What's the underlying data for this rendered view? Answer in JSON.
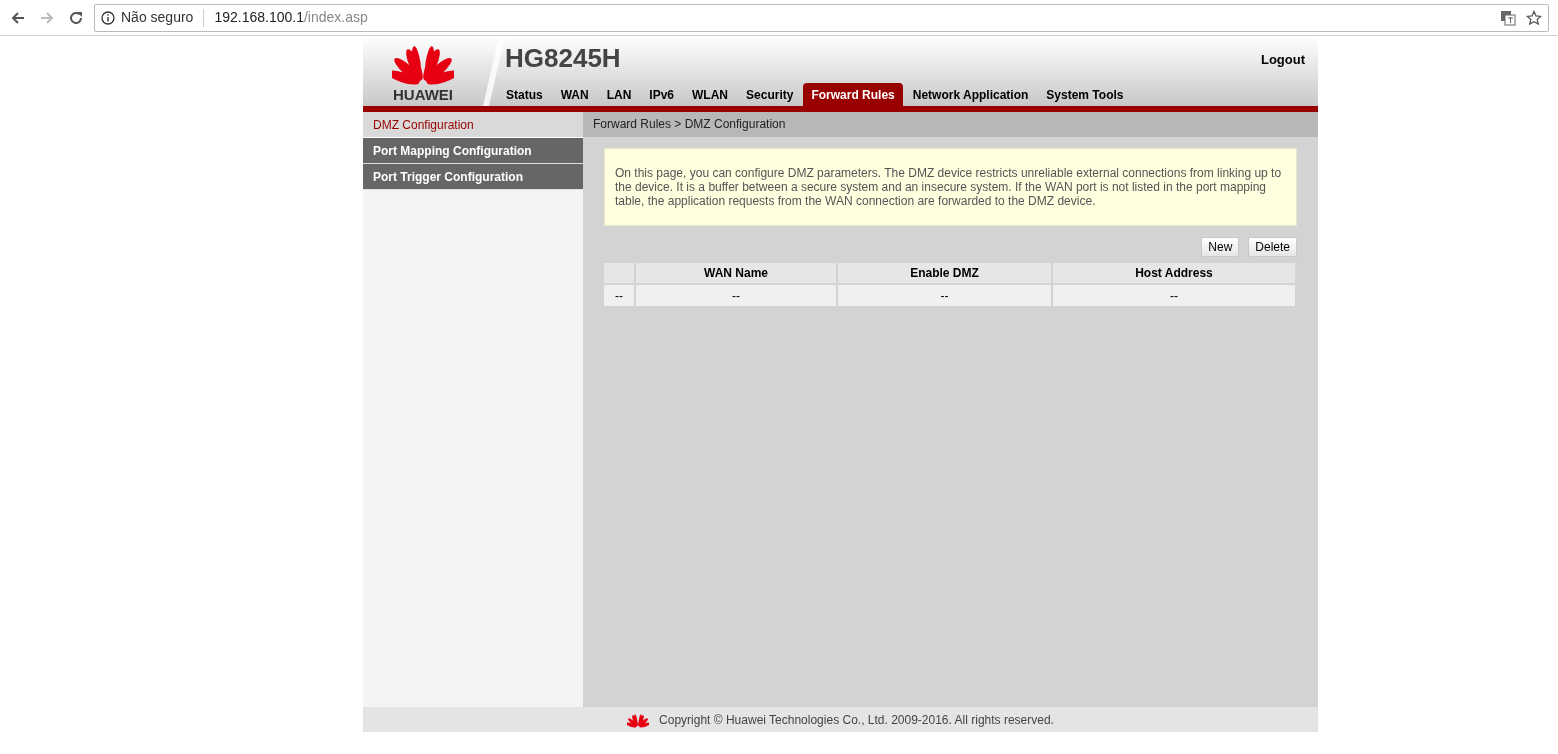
{
  "browser": {
    "security_label": "Não seguro",
    "url_host": "192.168.100.1",
    "url_path": "/index.asp"
  },
  "header": {
    "brand": "HUAWEI",
    "model": "HG8245H",
    "logout": "Logout",
    "tabs": [
      {
        "label": "Status",
        "selected": false
      },
      {
        "label": "WAN",
        "selected": false
      },
      {
        "label": "LAN",
        "selected": false
      },
      {
        "label": "IPv6",
        "selected": false
      },
      {
        "label": "WLAN",
        "selected": false
      },
      {
        "label": "Security",
        "selected": false
      },
      {
        "label": "Forward Rules",
        "selected": true
      },
      {
        "label": "Network Application",
        "selected": false
      },
      {
        "label": "System Tools",
        "selected": false
      }
    ]
  },
  "sidebar": {
    "items": [
      {
        "label": "DMZ Configuration",
        "selected": true
      },
      {
        "label": "Port Mapping Configuration",
        "selected": false
      },
      {
        "label": "Port Trigger Configuration",
        "selected": false
      }
    ]
  },
  "breadcrumb": "Forward Rules > DMZ Configuration",
  "notice": "On this page, you can configure DMZ parameters. The DMZ device restricts unreliable external connections from linking up to the device. It is a buffer between a secure system and an insecure system. If the WAN port is not listed in the port mapping table, the application requests from the WAN connection are forwarded to the DMZ device.",
  "buttons": [
    "New",
    "Delete"
  ],
  "table": {
    "columns": [
      "",
      "WAN Name",
      "Enable DMZ",
      "Host Address"
    ],
    "rows": [
      [
        "--",
        "--",
        "--",
        "--"
      ]
    ]
  },
  "footer": "Copyright © Huawei Technologies Co., Ltd. 2009-2016. All rights reserved."
}
